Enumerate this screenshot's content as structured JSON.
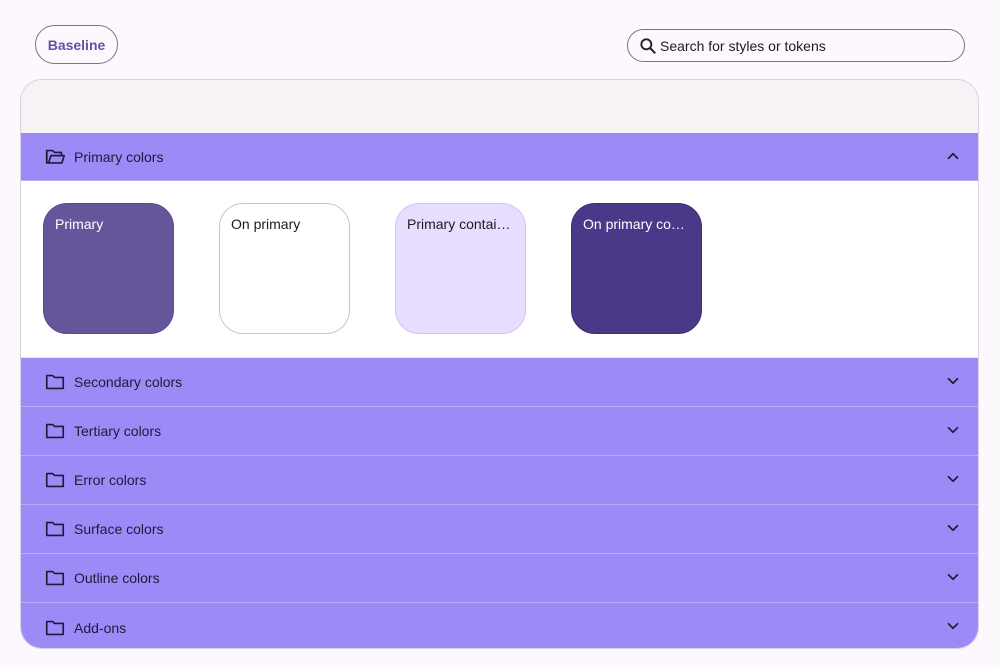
{
  "topbar": {
    "baseline_label": "Baseline",
    "search_placeholder": "Search for styles or tokens"
  },
  "colors": {
    "accent": "#6750a4",
    "section_header_bg": "#9c8af7"
  },
  "sections": [
    {
      "label": "Primary colors",
      "expanded": true,
      "icon": "folder-open-icon",
      "swatches": [
        {
          "label": "Primary",
          "color": "#65559b",
          "text_color": "#ffffff"
        },
        {
          "label": "On primary",
          "color": "#ffffff",
          "text_color": "#1d1b20"
        },
        {
          "label": "Primary contain...",
          "color": "#e9ddff",
          "text_color": "#1d1b20"
        },
        {
          "label": "On primary con...",
          "color": "#4a3889",
          "text_color": "#ffffff"
        }
      ]
    },
    {
      "label": "Secondary colors",
      "expanded": false,
      "icon": "folder-icon"
    },
    {
      "label": "Tertiary colors",
      "expanded": false,
      "icon": "folder-icon"
    },
    {
      "label": "Error colors",
      "expanded": false,
      "icon": "folder-icon"
    },
    {
      "label": "Surface colors",
      "expanded": false,
      "icon": "folder-icon"
    },
    {
      "label": "Outline colors",
      "expanded": false,
      "icon": "folder-icon"
    },
    {
      "label": "Add-ons",
      "expanded": false,
      "icon": "folder-icon"
    }
  ]
}
